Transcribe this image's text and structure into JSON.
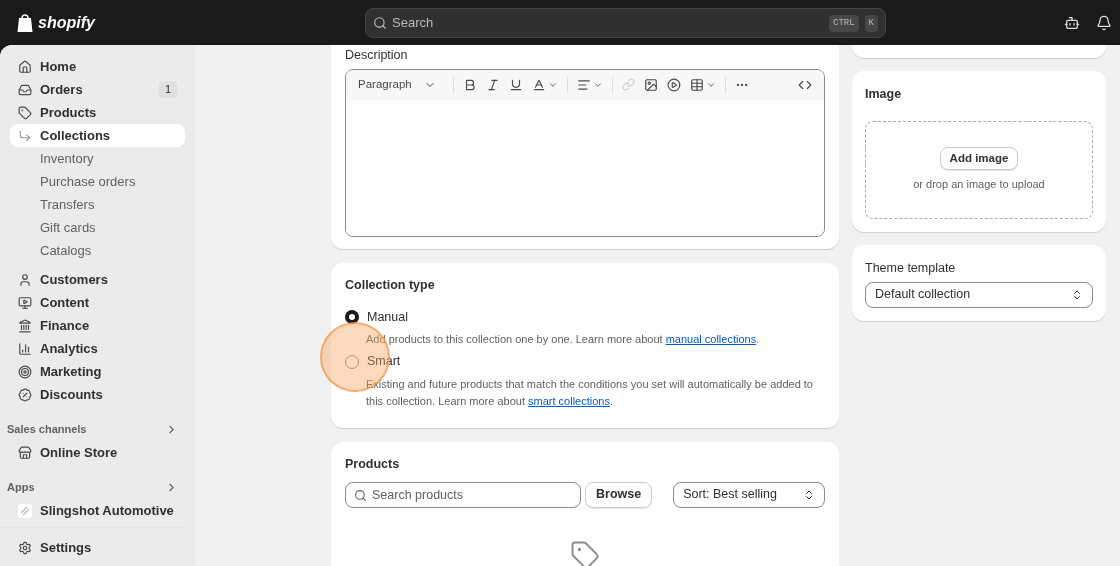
{
  "topbar": {
    "logo": "shopify",
    "search": {
      "placeholder": "Search",
      "keys": [
        "CTRL",
        "K"
      ]
    }
  },
  "nav": {
    "items": [
      {
        "label": "Home",
        "kind": "main",
        "selected": false
      },
      {
        "label": "Orders",
        "kind": "main",
        "selected": false,
        "badge": "1"
      },
      {
        "label": "Products",
        "kind": "main",
        "selected": false
      },
      {
        "label": "Collections",
        "kind": "sub",
        "selected": true
      },
      {
        "label": "Inventory",
        "kind": "sub",
        "selected": false
      },
      {
        "label": "Purchase orders",
        "kind": "sub",
        "selected": false
      },
      {
        "label": "Transfers",
        "kind": "sub",
        "selected": false
      },
      {
        "label": "Gift cards",
        "kind": "sub",
        "selected": false
      },
      {
        "label": "Catalogs",
        "kind": "sub",
        "selected": false
      },
      {
        "label": "Customers",
        "kind": "main",
        "selected": false
      },
      {
        "label": "Content",
        "kind": "main",
        "selected": false
      },
      {
        "label": "Finance",
        "kind": "main",
        "selected": false
      },
      {
        "label": "Analytics",
        "kind": "main",
        "selected": false
      },
      {
        "label": "Marketing",
        "kind": "main",
        "selected": false
      },
      {
        "label": "Discounts",
        "kind": "main",
        "selected": false
      }
    ],
    "sections": [
      {
        "title": "Sales channels",
        "items": [
          {
            "label": "Online Store",
            "selected": false
          }
        ]
      },
      {
        "title": "Apps",
        "items": [
          {
            "label": "Slingshot Automotive",
            "selected": false
          }
        ]
      }
    ],
    "settings": "Settings"
  },
  "description": {
    "label": "Description",
    "format": "Paragraph"
  },
  "collection_type": {
    "title": "Collection type",
    "options": [
      {
        "label": "Manual",
        "selected": true,
        "text": "Add products to this collection one by one. Learn more about ",
        "link": "manual collections",
        "after": "."
      },
      {
        "label": "Smart",
        "selected": false,
        "text": "Existing and future products that match the conditions you set will automatically be added to this collection. Learn more about ",
        "link": "smart collections",
        "after": "."
      }
    ]
  },
  "products": {
    "title": "Products",
    "search_placeholder": "Search products",
    "browse": "Browse",
    "sort": "Sort: Best selling"
  },
  "image": {
    "title": "Image",
    "button": "Add image",
    "hint": "or drop an image to upload"
  },
  "theme_template": {
    "title": "Theme template",
    "value": "Default collection"
  }
}
